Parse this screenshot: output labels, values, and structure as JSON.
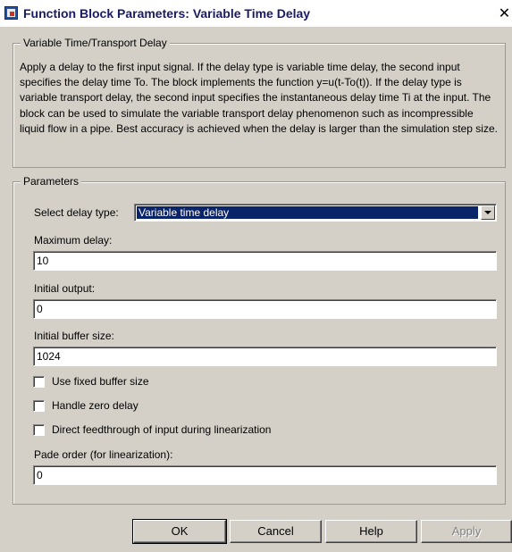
{
  "window": {
    "title": "Function Block Parameters: Variable Time Delay",
    "close_glyph": "✕"
  },
  "description_group": {
    "title": "Variable Time/Transport Delay",
    "text": "Apply a delay to the first input signal.  If the delay type is variable time delay, the second input specifies the delay time To. The block implements the function y=u(t-To(t)). If the delay type is variable transport delay, the second input specifies the instantaneous delay time Ti at the input. The block can be used to simulate the variable transport delay phenomenon such as incompressible liquid flow in a pipe. Best accuracy is achieved when the delay is larger than the simulation step size."
  },
  "parameters": {
    "title": "Parameters",
    "delay_type": {
      "label": "Select delay type:",
      "value": "Variable time delay"
    },
    "max_delay": {
      "label": "Maximum delay:",
      "value": "10"
    },
    "initial_output": {
      "label": "Initial output:",
      "value": "0"
    },
    "buffer_size": {
      "label": "Initial buffer size:",
      "value": "1024"
    },
    "checkboxes": [
      {
        "label": "Use fixed buffer size",
        "checked": false
      },
      {
        "label": "Handle zero delay",
        "checked": false
      },
      {
        "label": "Direct feedthrough of input during linearization",
        "checked": false
      }
    ],
    "pade_order": {
      "label": "Pade order (for linearization):",
      "value": "0"
    }
  },
  "buttons": {
    "ok": "OK",
    "cancel": "Cancel",
    "help": "Help",
    "apply": "Apply"
  },
  "colors": {
    "dialog_bg": "#d4d0c8",
    "title_text": "#1a1a6a",
    "selection_bg": "#0a246a"
  },
  "icons": {
    "app": "simulink-block-icon",
    "close": "close-icon",
    "dropdown": "chevron-down-icon"
  }
}
